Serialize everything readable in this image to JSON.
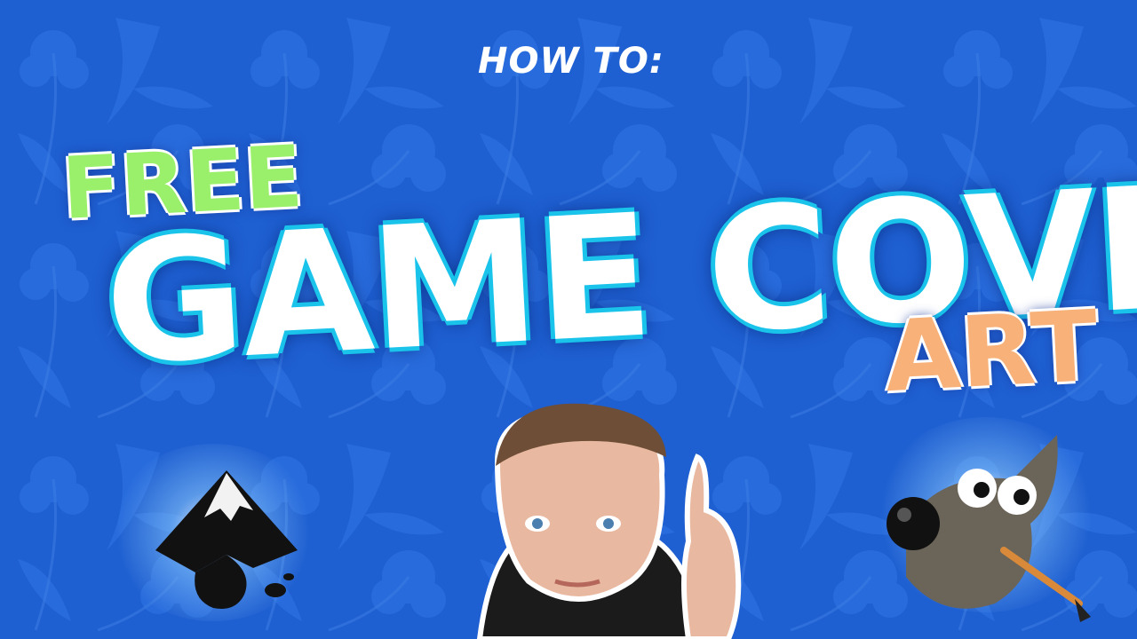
{
  "thumbnail": {
    "kicker": "HOW TO:",
    "line1": "FREE",
    "line2": "GAME COVER",
    "line3": "ART"
  },
  "colors": {
    "background": "#1f63d6",
    "free_green": "#9af06a",
    "art_orange": "#f7b179",
    "outline_cyan": "#19c3ea"
  },
  "icons": [
    "inkscape-logo-icon",
    "gimp-wilber-logo-icon"
  ]
}
